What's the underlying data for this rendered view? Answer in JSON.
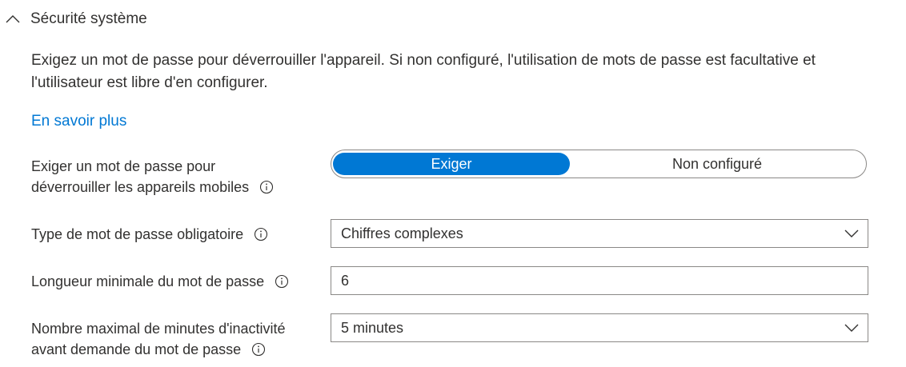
{
  "section": {
    "title": "Sécurité système",
    "description": "Exigez un mot de passe pour déverrouiller l'appareil. Si non configuré, l'utilisation de mots de passe est facultative et l'utilisateur est libre d'en configurer.",
    "learn_more": "En savoir plus"
  },
  "settings": {
    "require_password": {
      "label_line1": "Exiger un mot de passe pour",
      "label_line2": "déverrouiller les appareils mobiles",
      "options": [
        "Exiger",
        "Non configuré"
      ],
      "selected": "Exiger"
    },
    "password_type": {
      "label": "Type de mot de passe obligatoire",
      "value": "Chiffres complexes"
    },
    "min_length": {
      "label": "Longueur minimale du mot de passe",
      "value": "6"
    },
    "max_inactivity": {
      "label_line1": "Nombre maximal de minutes d'inactivité",
      "label_line2": "avant demande du mot de passe",
      "value": "5 minutes"
    }
  },
  "colors": {
    "accent": "#0078d4",
    "text": "#323130",
    "border": "#8a8886"
  }
}
